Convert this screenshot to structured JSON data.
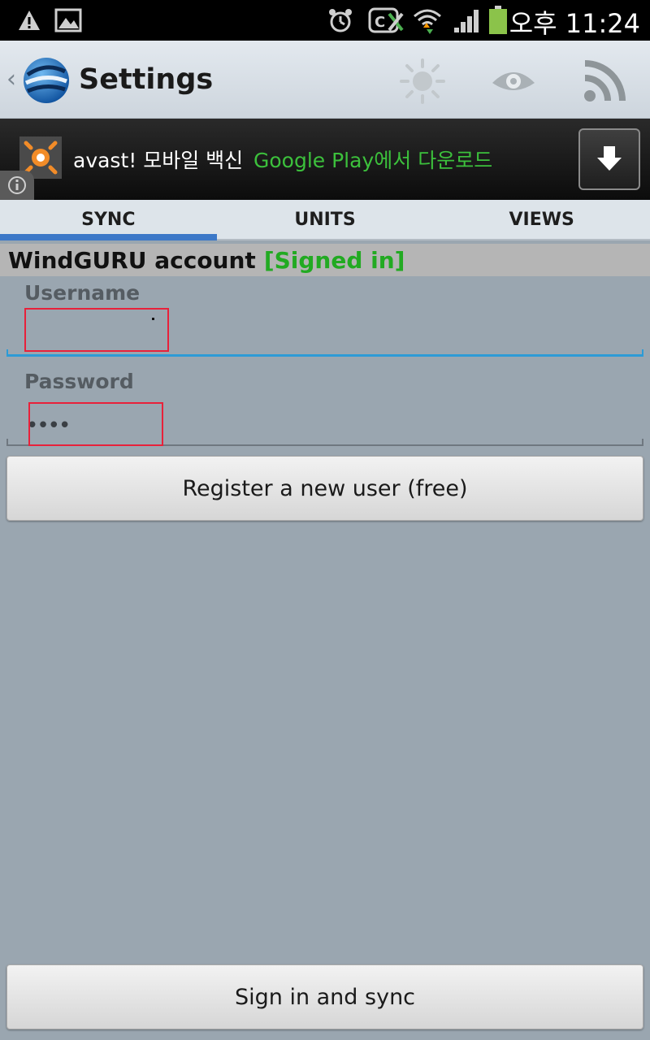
{
  "status_bar": {
    "time": "오후 11:24",
    "icons": [
      "warning-icon",
      "image-icon",
      "alarm-icon",
      "screen-mirror-icon",
      "wifi-icon",
      "signal-icon",
      "battery-icon"
    ]
  },
  "action_bar": {
    "title": "Settings",
    "actions": [
      "brightness-icon",
      "eye-icon",
      "rss-icon"
    ]
  },
  "ad": {
    "app_name": "avast! 모바일 백신",
    "cta": "Google Play에서 다운로드"
  },
  "tabs": [
    {
      "label": "SYNC",
      "active": true
    },
    {
      "label": "UNITS",
      "active": false
    },
    {
      "label": "VIEWS",
      "active": false
    }
  ],
  "account": {
    "title": "WindGURU account",
    "status": "[Signed in]"
  },
  "form": {
    "username_label": "Username",
    "username_value": "",
    "password_label": "Password",
    "password_value": "••••"
  },
  "buttons": {
    "register": "Register a new user (free)",
    "sign_in": "Sign in and sync"
  },
  "colors": {
    "accent_blue": "#3c78c8",
    "signed_in_green": "#22aa22",
    "focus_line": "#2d9bd6",
    "highlight_red": "#e8213a"
  }
}
